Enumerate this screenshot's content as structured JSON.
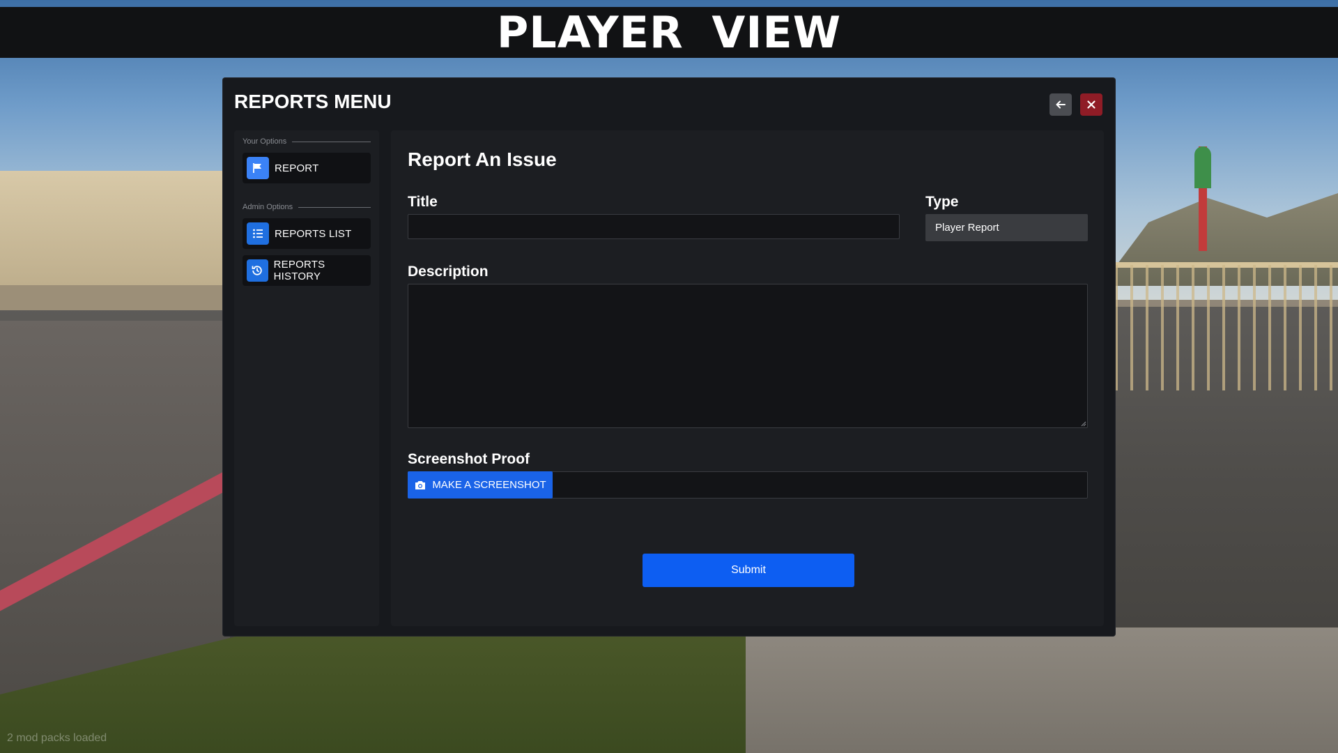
{
  "banner": {
    "title": "PLAYER  VIEW"
  },
  "modal": {
    "title": "REPORTS MENU",
    "back_icon": "arrow-left-icon",
    "close_icon": "close-icon",
    "colors": {
      "accent": "#0d5ef2",
      "close": "#8f1c26"
    }
  },
  "sidebar": {
    "your_options_label": "Your Options",
    "admin_options_label": "Admin Options",
    "items": [
      {
        "label": "REPORT",
        "icon": "flag-icon"
      },
      {
        "label": "REPORTS LIST",
        "icon": "list-icon"
      },
      {
        "label": "REPORTS HISTORY",
        "icon": "history-icon"
      }
    ]
  },
  "form": {
    "heading": "Report An Issue",
    "title_label": "Title",
    "title_value": "",
    "type_label": "Type",
    "type_value": "Player Report",
    "description_label": "Description",
    "description_value": "",
    "screenshot_label": "Screenshot Proof",
    "screenshot_button": "MAKE A SCREENSHOT",
    "screenshot_icon": "camera-icon",
    "submit_label": "Submit"
  },
  "footer": {
    "status": "2 mod packs loaded"
  }
}
